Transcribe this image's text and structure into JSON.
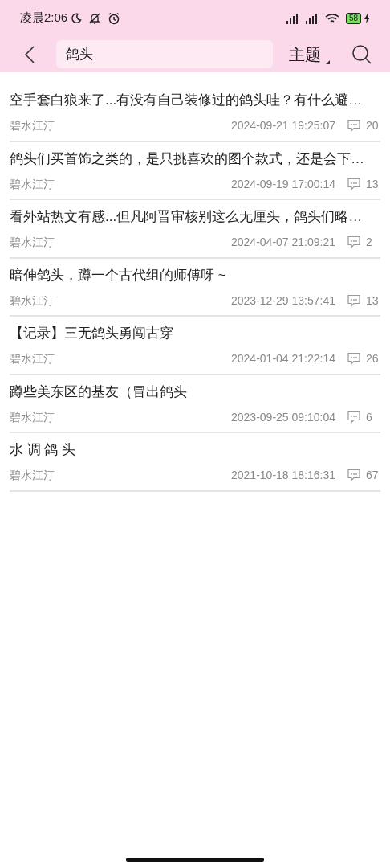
{
  "status_bar": {
    "time": "凌晨2:06",
    "battery": "58"
  },
  "header": {
    "search_value": "鸽头",
    "scope": "主题"
  },
  "results": [
    {
      "title": "空手套白狼来了...有没有自己装修过的鸽头哇？有什么避…",
      "author": "碧水江汀",
      "time": "2024-09-21 19:25:07",
      "replies": "20"
    },
    {
      "title": "鸽头们买首饰之类的，是只挑喜欢的图个款式，还是会下…",
      "author": "碧水江汀",
      "time": "2024-09-19 17:00:14",
      "replies": "13"
    },
    {
      "title": "看外站热文有感...但凡阿晋审核别这么无厘头，鸽头们略…",
      "author": "碧水江汀",
      "time": "2024-04-07 21:09:21",
      "replies": "2"
    },
    {
      "title": "暗伸鸽头，蹲一个古代组的师傅呀 ~",
      "author": "碧水江汀",
      "time": "2023-12-29 13:57:41",
      "replies": "13"
    },
    {
      "title": "【记录】三无鸽头勇闯古穿",
      "author": "碧水江汀",
      "time": "2024-01-04 21:22:14",
      "replies": "26"
    },
    {
      "title": "蹲些美东区的基友（冒出鸽头",
      "author": "碧水江汀",
      "time": "2023-09-25 09:10:04",
      "replies": "6"
    },
    {
      "title": "水 调 鸽 头",
      "author": "碧水江汀",
      "time": "2021-10-18 18:16:31",
      "replies": "67"
    }
  ]
}
